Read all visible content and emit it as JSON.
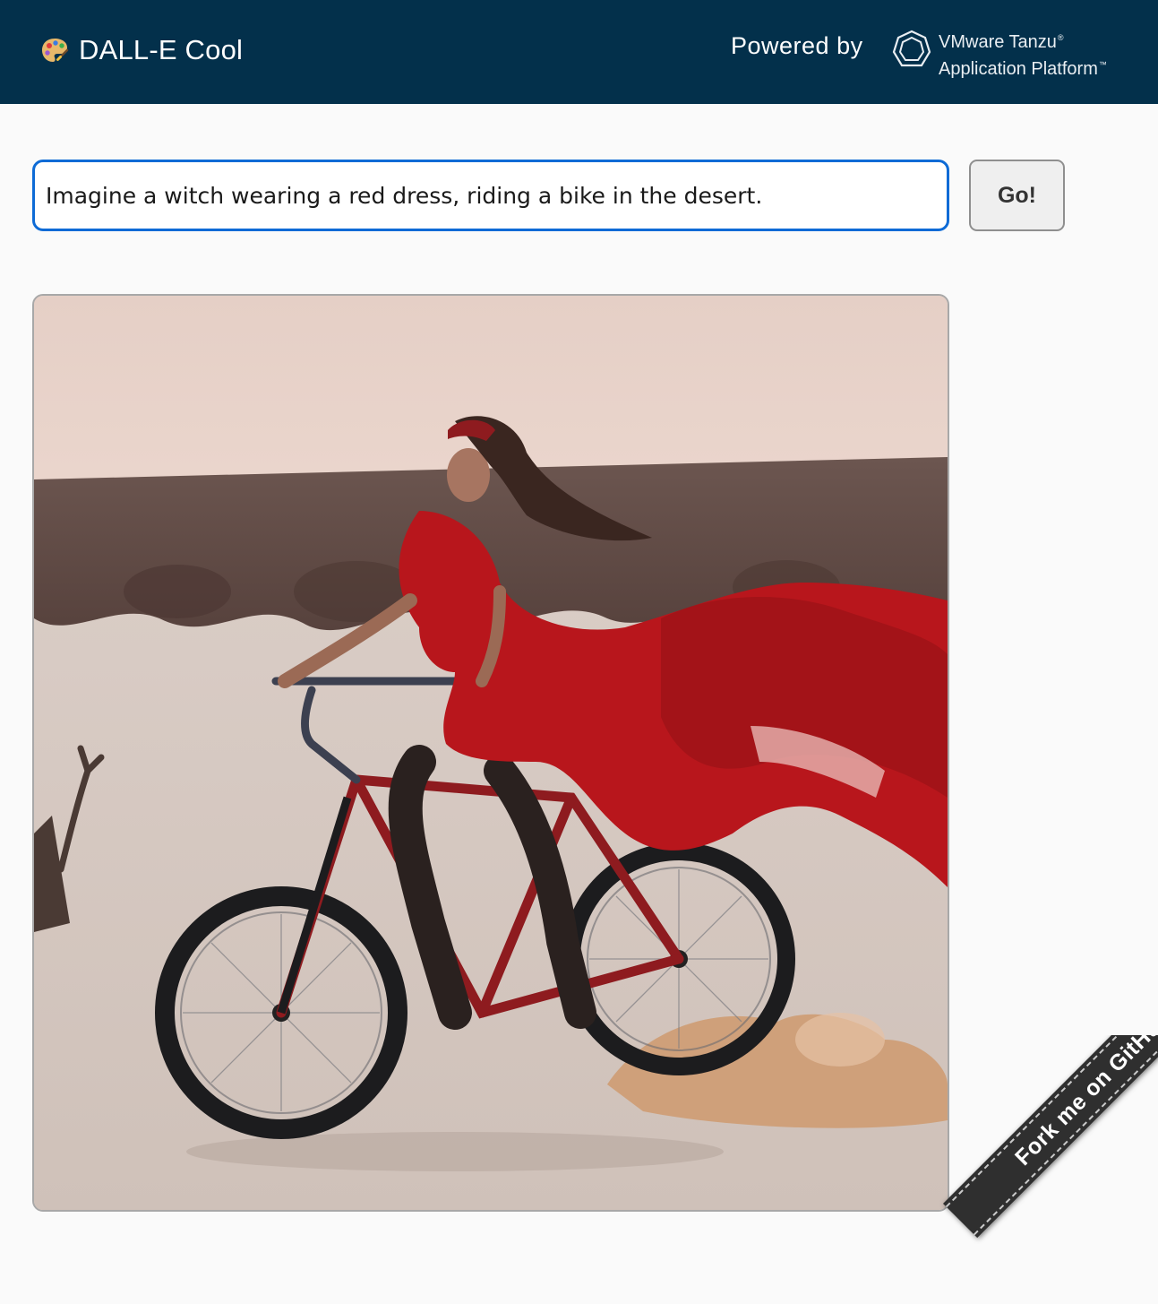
{
  "header": {
    "app_icon": "artist-palette-icon",
    "title": "DALL-E Cool",
    "powered_by": "Powered by",
    "platform_line1": "VMware Tanzu",
    "platform_line1_mark": "®",
    "platform_line2": "Application Platform",
    "platform_line2_mark": "™",
    "platform_icon": "tanzu-hexagon-logo"
  },
  "prompt": {
    "value": "Imagine a witch wearing a red dress, riding a bike in the desert.",
    "placeholder": ""
  },
  "go_button": {
    "label": "Go!"
  },
  "result_image": {
    "alt": "Imagine a witch wearing a red dress, riding a bike in the desert."
  },
  "ribbon": {
    "label": "Fork me on GitHub"
  },
  "colors": {
    "header_bg": "#03304b",
    "input_border": "#0e6bd6",
    "ribbon_bg": "#2f2f2f"
  }
}
